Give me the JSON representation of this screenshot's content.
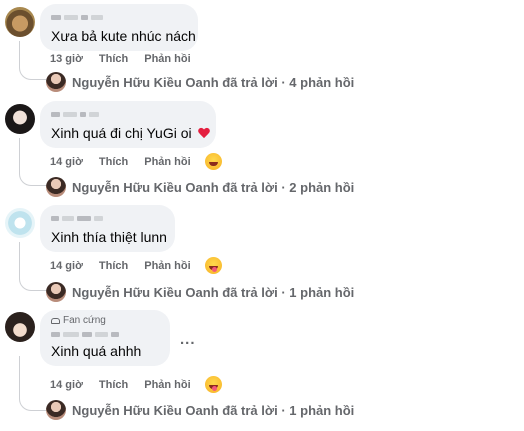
{
  "action_labels": {
    "like": "Thích",
    "reply": "Phản hồi"
  },
  "comments": [
    {
      "text": "Xưa bả kute nhúc nách",
      "time": "13 giờ",
      "reply_summary": "Nguyễn Hữu Kiều Oanh đã trả lời · 4 phản hồi",
      "reaction": null
    },
    {
      "text": "Xinh quá đi chị YuGi oi",
      "time": "14 giờ",
      "reply_summary": "Nguyễn Hữu Kiều Oanh đã trả lời · 2 phản hồi",
      "reaction": "haha-icon",
      "emoji": "heart-icon"
    },
    {
      "text": "Xinh thía thiệt lunn",
      "time": "14 giờ",
      "reply_summary": "Nguyễn Hữu Kiều Oanh đã trả lời · 1 phản hồi",
      "reaction": "tongue-icon"
    },
    {
      "text": "Xinh quá ahhh",
      "time": "14 giờ",
      "reply_summary": "Nguyễn Hữu Kiều Oanh đã trả lời · 1 phản hồi",
      "reaction": "tongue-icon",
      "badge": "Fan cứng",
      "more": "..."
    }
  ]
}
